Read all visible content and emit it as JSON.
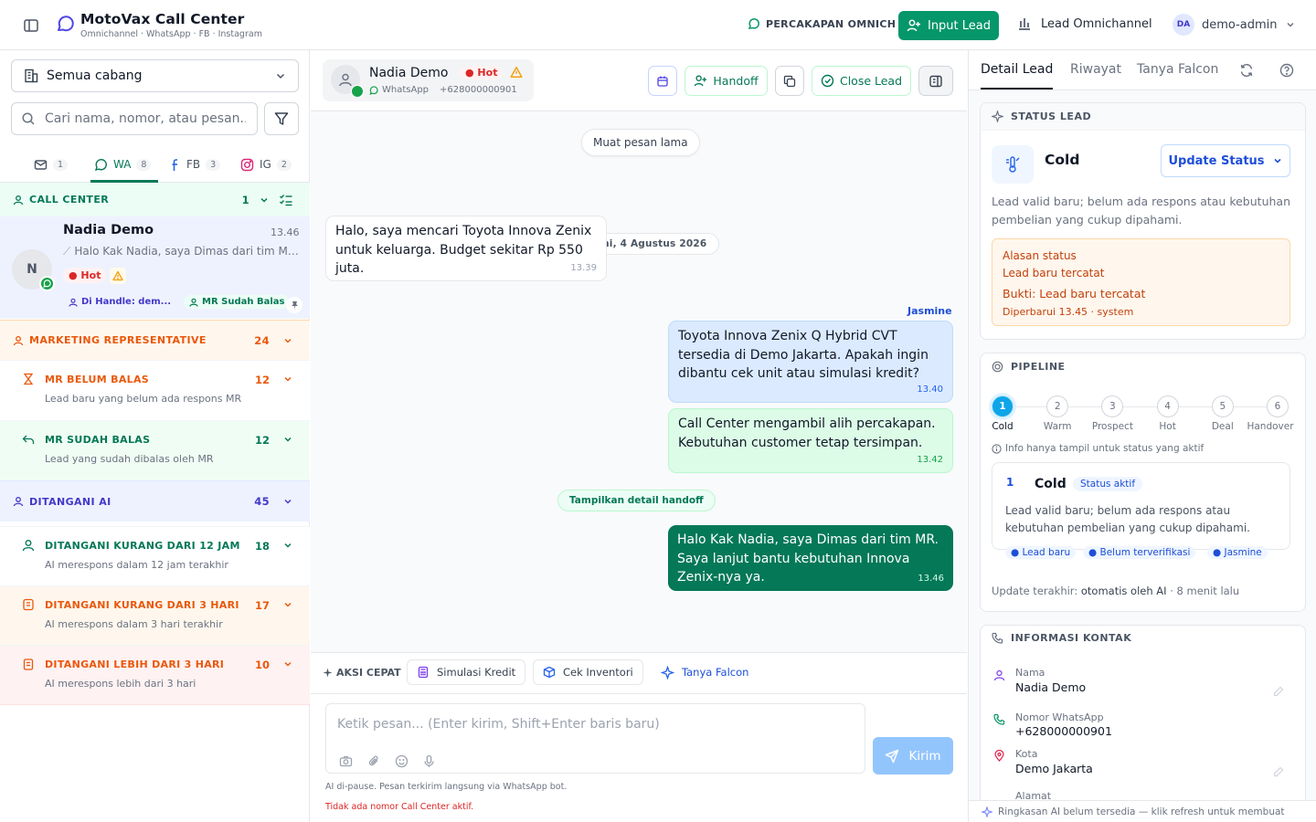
{
  "header": {
    "brand_title": "MotoVax Call Center",
    "brand_subtitle": "Omnichannel · WhatsApp · FB · Instagram",
    "omni_link": "PERCAKAPAN OMNICH",
    "input_lead": "Input Lead",
    "lead_omnichannel": "Lead Omnichannel",
    "user_initials": "DA",
    "user_name": "demo-admin"
  },
  "sidebar": {
    "branch_select": "Semua cabang",
    "search_placeholder": "Cari nama, nomor, atau pesan...",
    "tabs": [
      {
        "label": "",
        "count": "1",
        "icon": "inbox-icon"
      },
      {
        "label": "WA",
        "count": "8",
        "icon": "whatsapp-icon"
      },
      {
        "label": "FB",
        "count": "3",
        "icon": "facebook-icon"
      },
      {
        "label": "IG",
        "count": "2",
        "icon": "instagram-icon"
      }
    ],
    "groups": {
      "call_center": {
        "label": "CALL CENTER",
        "count": "1"
      },
      "marketing": {
        "label": "MARKETING REPRESENTATIVE",
        "count": "24"
      },
      "mr_belum": {
        "label": "MR BELUM BALAS",
        "count": "12",
        "desc": "Lead baru yang belum ada respons MR"
      },
      "mr_sudah": {
        "label": "MR SUDAH BALAS",
        "count": "12",
        "desc": "Lead yang sudah dibalas oleh MR"
      },
      "ditangani_ai": {
        "label": "DITANGANI AI",
        "count": "45"
      },
      "ai_12jam": {
        "label": "DITANGANI KURANG DARI 12 JAM",
        "count": "18",
        "desc": "AI merespons dalam 12 jam terakhir"
      },
      "ai_3hari": {
        "label": "DITANGANI KURANG DARI 3 HARI",
        "count": "17",
        "desc": "AI merespons dalam 3 hari terakhir"
      },
      "ai_lebih3": {
        "label": "DITANGANI LEBIH DARI 3 HARI",
        "count": "10",
        "desc": "AI merespons lebih dari 3 hari"
      }
    },
    "conversation": {
      "initial": "N",
      "name": "Nadia Demo",
      "time": "13.46",
      "preview": "Halo Kak Nadia, saya Dimas dari tim MR. Saya lanjut bantu",
      "hot": "● Hot",
      "handled": "Di Handle: dem...",
      "replied": "MR Sudah Balas"
    }
  },
  "chat": {
    "contact_name": "Nadia Demo",
    "hot": "● Hot",
    "channel": "WhatsApp",
    "phone": "+628000000901",
    "handoff": "Handoff",
    "close_lead": "Close Lead",
    "load_older": "Muat pesan lama",
    "date": "Hari ini, 4 Agustus 2026",
    "messages": [
      {
        "text": "Halo, saya mencari Toyota Innova Zenix untuk keluarga. Budget sekitar Rp 550 juta.",
        "time": "13.39"
      },
      {
        "sender": "Jasmine",
        "text": "Toyota Innova Zenix Q Hybrid CVT tersedia di Demo Jakarta. Apakah ingin dibantu cek unit atau simulasi kredit?",
        "time": "13.40"
      },
      {
        "text": "Call Center mengambil alih percakapan. Kebutuhan customer tetap tersimpan.",
        "time": "13.42"
      },
      {
        "text": "Halo Kak Nadia, saya Dimas dari tim MR. Saya lanjut bantu kebutuhan Innova Zenix-nya ya.",
        "time": "13.46"
      }
    ],
    "handoff_detail": "Tampilkan detail handoff",
    "quick_actions_label": "AKSI CEPAT",
    "quick_actions": [
      "Simulasi Kredit",
      "Cek Inventori",
      "Tanya Falcon"
    ],
    "composer_placeholder": "Ketik pesan... (Enter kirim, Shift+Enter baris baru)",
    "send": "Kirim",
    "ai_paused_note": "AI di-pause. Pesan terkirim langsung via WhatsApp bot.",
    "no_cc_note": "Tidak ada nomor Call Center aktif."
  },
  "detail": {
    "tabs": [
      "Detail Lead",
      "Riwayat",
      "Tanya Falcon"
    ],
    "status": {
      "head": "STATUS LEAD",
      "name": "Cold",
      "update_btn": "Update Status",
      "desc": "Lead valid baru; belum ada respons atau kebutuhan pembelian yang cukup dipahami.",
      "reason_label": "Alasan status",
      "reason_value": "Lead baru tercatat",
      "evidence": "Bukti: Lead baru tercatat",
      "updated": "Diperbarui 13.45 · system"
    },
    "pipeline": {
      "head": "PIPELINE",
      "steps": [
        {
          "num": "1",
          "label": "Cold"
        },
        {
          "num": "2",
          "label": "Warm"
        },
        {
          "num": "3",
          "label": "Prospect"
        },
        {
          "num": "4",
          "label": "Hot"
        },
        {
          "num": "5",
          "label": "Deal"
        },
        {
          "num": "6",
          "label": "Handover"
        }
      ],
      "active_step": 1,
      "info": "Info hanya tampil untuk status yang aktif",
      "detail_num": "1",
      "detail_name": "Cold",
      "detail_badge": "Status aktif",
      "detail_desc": "Lead valid baru; belum ada respons atau kebutuhan pembelian yang cukup dipahami.",
      "tags": [
        "● Lead baru",
        "● Belum terverifikasi",
        "● Jasmine"
      ],
      "update_label": "Update terakhir:",
      "update_value": "otomatis oleh AI",
      "update_ago": "· 8 menit lalu"
    },
    "contact": {
      "head": "INFORMASI KONTAK",
      "name_label": "Nama",
      "name_value": "Nadia Demo",
      "phone_label": "Nomor WhatsApp",
      "phone_value": "+628000000901",
      "city_label": "Kota",
      "city_value": "Demo Jakarta",
      "address_label": "Alamat"
    },
    "ai_summary": "Ringkasan AI belum tersedia — klik refresh untuk membuat"
  },
  "colors": {
    "brand": "#4f46e5",
    "primary_green": "#059669",
    "dark_green": "#047857",
    "hot_red": "#dc2626",
    "orange": "#ea580c",
    "indigo": "#4338ca"
  }
}
